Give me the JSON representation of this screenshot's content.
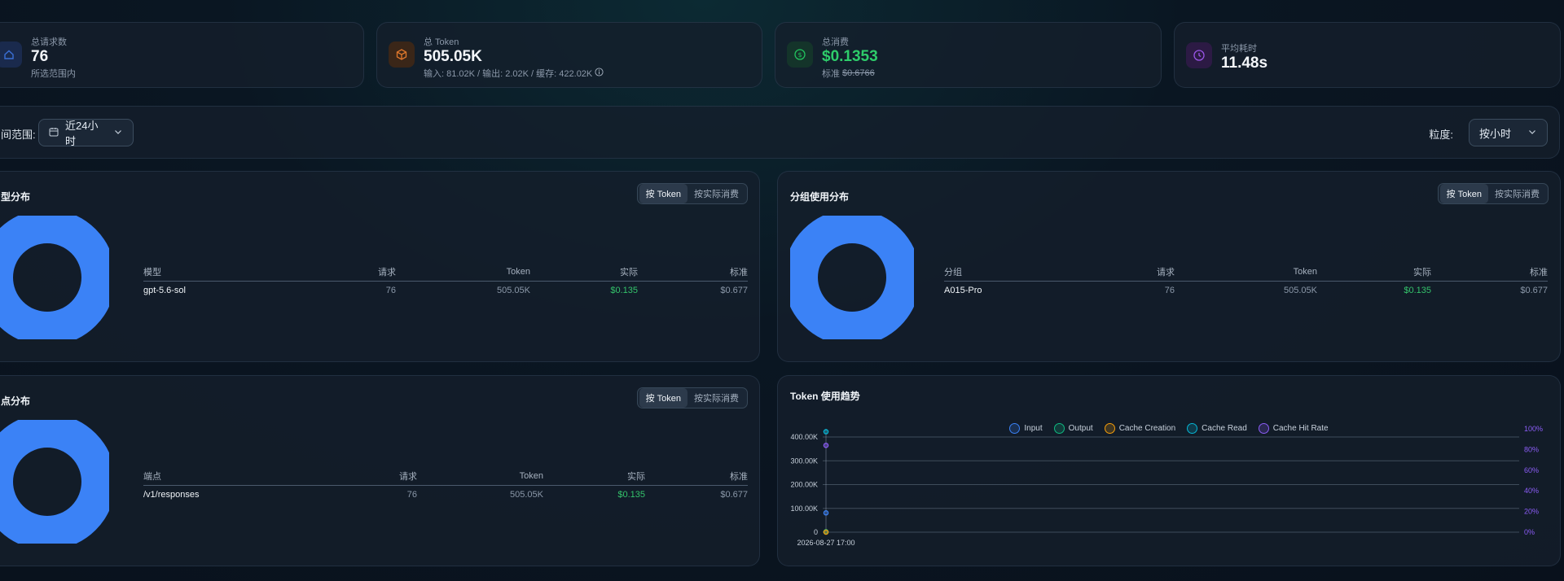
{
  "stats": [
    {
      "label": "总请求数",
      "value": "76",
      "sub": "所选范围内",
      "icon": "home-icon",
      "color": "#3b6fd6"
    },
    {
      "label": "总 Token",
      "value": "505.05K",
      "sub": "输入: 81.02K / 输出: 2.02K / 缓存: 422.02K",
      "icon": "box-icon",
      "color": "#e0782c"
    },
    {
      "label": "总消费",
      "value": "$0.1353",
      "sub_prefix": "标准",
      "sub_strike": "$0.6766",
      "icon": "dollar-icon",
      "color": "#22c35e"
    },
    {
      "label": "平均耗时",
      "value": "11.48s",
      "icon": "clock-icon",
      "color": "#9a55e8"
    }
  ],
  "filter": {
    "range_label": "间范围:",
    "range_value": "近24小时",
    "granularity_label": "粒度:",
    "granularity_value": "按小时"
  },
  "toggle": {
    "token": "按 Token",
    "cost": "按实际消费"
  },
  "colors": {
    "accent": "#3b82f6",
    "green": "#34c36b"
  },
  "panels": {
    "model": {
      "title": "型分布",
      "headers": [
        "模型",
        "请求",
        "Token",
        "实际",
        "标准"
      ],
      "rows": [
        {
          "name": "gpt-5.6-sol",
          "requests": "76",
          "tokens": "505.05K",
          "actual": "$0.135",
          "standard": "$0.677"
        }
      ]
    },
    "group": {
      "title": "分组使用分布",
      "headers": [
        "分组",
        "请求",
        "Token",
        "实际",
        "标准"
      ],
      "rows": [
        {
          "name": "A015-Pro",
          "requests": "76",
          "tokens": "505.05K",
          "actual": "$0.135",
          "standard": "$0.677"
        }
      ]
    },
    "endpoint": {
      "title": "点分布",
      "headers": [
        "端点",
        "请求",
        "Token",
        "实际",
        "标准"
      ],
      "rows": [
        {
          "name": "/v1/responses",
          "requests": "76",
          "tokens": "505.05K",
          "actual": "$0.135",
          "standard": "$0.677"
        }
      ]
    },
    "trend": {
      "title": "Token 使用趋势"
    }
  },
  "chart_data": {
    "type": "line",
    "x": [
      "2026-08-27 17:00"
    ],
    "series": [
      {
        "name": "Input",
        "values": [
          81020
        ],
        "color": "#3b82f6",
        "axis": "left"
      },
      {
        "name": "Output",
        "values": [
          2020
        ],
        "color": "#10b981",
        "axis": "left"
      },
      {
        "name": "Cache Creation",
        "values": [
          0
        ],
        "color": "#f59e0b",
        "axis": "left"
      },
      {
        "name": "Cache Read",
        "values": [
          422020
        ],
        "color": "#06b6d4",
        "axis": "left"
      },
      {
        "name": "Cache Hit Rate",
        "values": [
          84
        ],
        "color": "#8b5cf6",
        "axis": "right"
      }
    ],
    "yticks": [
      "0",
      "100.00K",
      "200.00K",
      "300.00K",
      "400.00K"
    ],
    "y2ticks": [
      "0%",
      "20%",
      "40%",
      "60%",
      "80%",
      "100%"
    ],
    "ylim": [
      0,
      400000
    ],
    "y2lim": [
      0,
      100
    ],
    "grid": true,
    "legend": "top"
  }
}
